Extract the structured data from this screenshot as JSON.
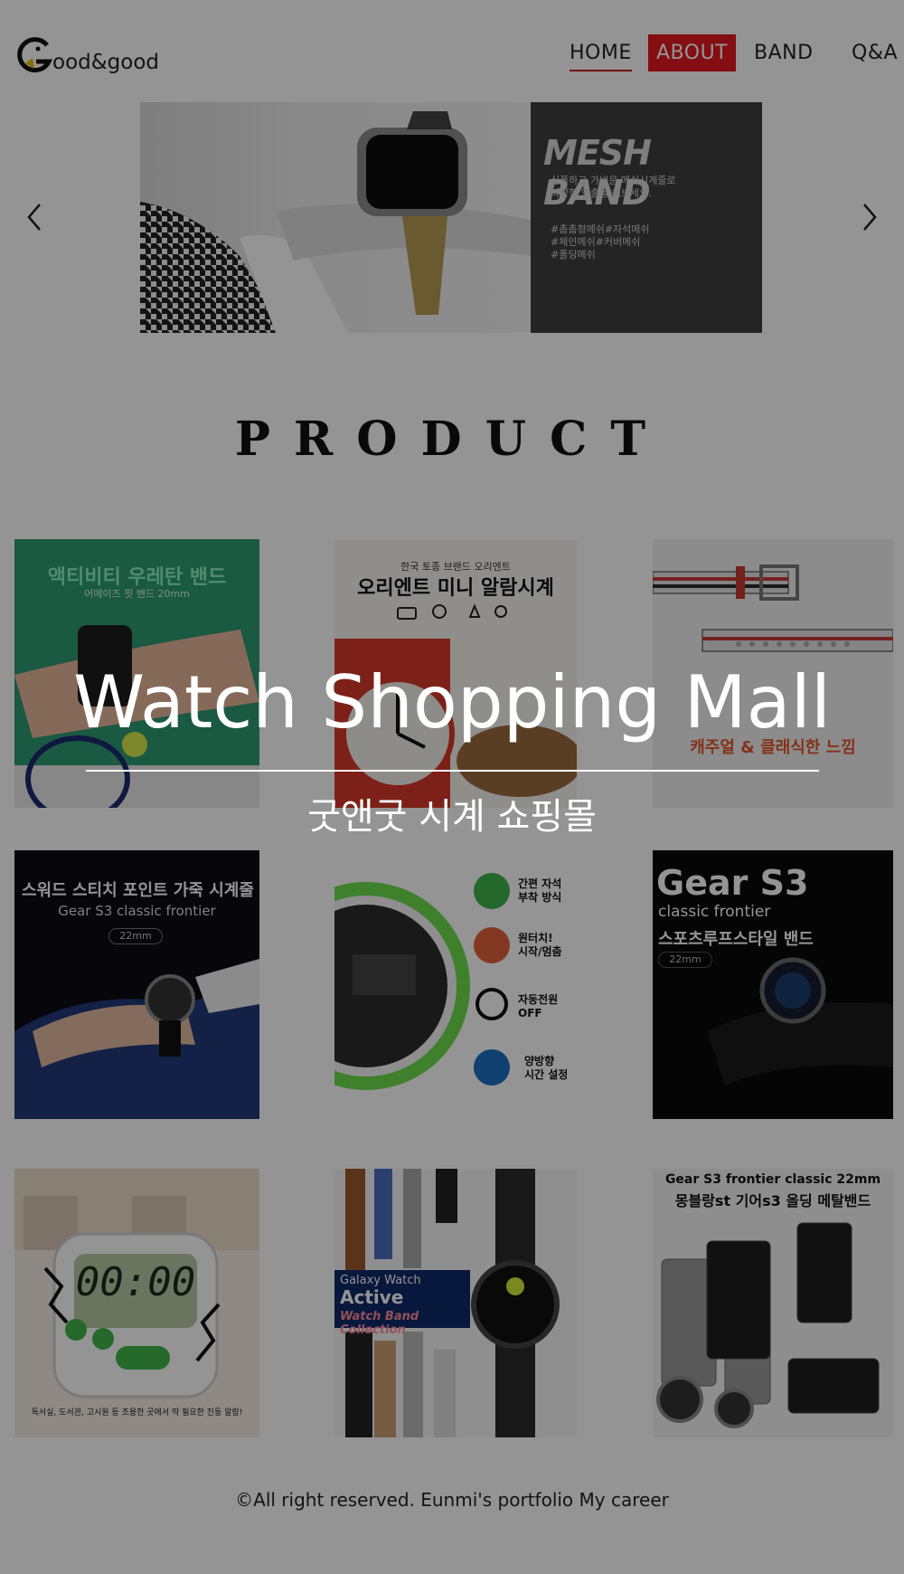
{
  "header": {
    "logo_text": "ood&good",
    "nav": {
      "home": "HOME",
      "about": "ABOUT",
      "band": "BAND",
      "qa": "Q&A"
    }
  },
  "banner": {
    "title": "MESH BAND",
    "desc_line1": "심플하고 가벼운 메쉬시계줄로",
    "desc_line2": "다양한 연출을 해보세요.",
    "tags_line1": "#촘촘형메쉬#자석메쉬",
    "tags_line2": "#체인메쉬#커버메쉬",
    "tags_line3": "#폴딩메쉬"
  },
  "product": {
    "heading": "PRODUCT"
  },
  "cards": {
    "c1": {
      "title": "액티비티 우레탄 밴드",
      "sub": "어메이즈 핏 밴드 20mm"
    },
    "c2": {
      "top": "한국 토종 브랜드 오리엔트",
      "title": "오리엔트 미니 알람시계"
    },
    "c3": {
      "title": "캐주얼 & 클래식한 느낌"
    },
    "c4": {
      "title": "스워드 스티치 포인트 가죽 시계줄",
      "sub": "Gear S3 classic frontier",
      "size": "22mm"
    },
    "c5": {
      "f1": "간편 자석\n부착 방식",
      "f2": "원터치!\n시작/멈춤",
      "f3": "자동전원\nOFF",
      "f4": "양방향\n시간 설정"
    },
    "c6": {
      "brand": "Gear S3",
      "model": "classic frontier",
      "title": "스포츠루프스타일 밴드",
      "size": "22mm"
    },
    "c7": {
      "display": "00:00",
      "caption": "독서실, 도서관, 고시원 등 조용한 곳에서 딱 필요한 진동 알람!"
    },
    "c8": {
      "line1": "Galaxy Watch",
      "line2": "Active",
      "line3": "Watch Band Collection"
    },
    "c9": {
      "line1": "Gear S3 frontier classic 22mm",
      "line2": "몽블랑st 기어s3 올딩 메탈밴드"
    }
  },
  "hero": {
    "title": "Watch Shopping Mall",
    "subtitle": "굿앤굿 시계 쇼핑몰"
  },
  "footer": {
    "text": "©All right reserved. Eunmi's portfolio My career"
  }
}
